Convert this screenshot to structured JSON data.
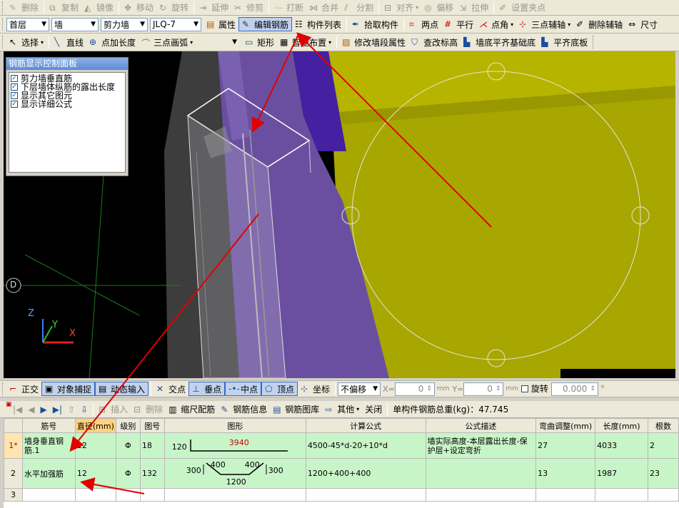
{
  "toolbar1": {
    "delete": "删除",
    "copy": "复制",
    "mirror": "镜像",
    "move": "移动",
    "rotate": "旋转",
    "extend": "延伸",
    "trim": "修剪",
    "break": "打断",
    "merge": "合并",
    "split": "分割",
    "align": "对齐",
    "offset": "偏移",
    "stretch": "拉伸",
    "set_grip": "设置夹点"
  },
  "toolbar2": {
    "floor": "首层",
    "category": "墙",
    "type": "剪力墙",
    "member": "JLQ-7",
    "properties": "属性",
    "edit_rebar": "编辑钢筋",
    "member_list": "构件列表",
    "pick_member": "拾取构件",
    "two_points": "两点",
    "parallel": "平行",
    "point_angle": "点角",
    "three_point_axis": "三点辅轴",
    "delete_axis": "删除辅轴",
    "size": "尺寸"
  },
  "toolbar3": {
    "select": "选择",
    "line": "直线",
    "point_length": "点加长度",
    "arc": "三点画弧",
    "blank_combo": "",
    "rect": "矩形",
    "smart_layout": "智能布置",
    "modify_seg": "修改墙段属性",
    "check_elev": "查改标高",
    "wall_bottom_align": "墙底平齐基础底",
    "align_bottom": "平齐底板"
  },
  "control_panel": {
    "title": "钢筋显示控制面板",
    "items": [
      "剪力墙垂直筋",
      "下层墙体纵筋的露出长度",
      "显示其它图元",
      "显示详细公式"
    ]
  },
  "viewport": {
    "axis_label": "D",
    "z": "Z",
    "y": "Y",
    "x": "X"
  },
  "snap_bar": {
    "ortho": "正交",
    "obj_snap": "对象捕捉",
    "dyn_input": "动态输入",
    "intersect": "交点",
    "perp": "垂点",
    "mid": "中点",
    "vertex": "顶点",
    "coord": "坐标",
    "offset_mode": "不偏移",
    "x_label": "X=",
    "x_val": "0",
    "unit1": "mm",
    "y_label": "Y=",
    "y_val": "0",
    "unit2": "mm",
    "rotate": "旋转",
    "rotate_val": "0.000",
    "deg": "°"
  },
  "rebar_toolbar": {
    "insert": "插入",
    "delete": "删除",
    "scale_rebar": "缩尺配筋",
    "rebar_info": "钢筋信息",
    "rebar_lib": "钢筋图库",
    "other": "其他",
    "close": "关闭",
    "total": "单构件钢筋总重(kg)：47.745"
  },
  "grid": {
    "headers": [
      "筋号",
      "直径(mm)",
      "级别",
      "图号",
      "图形",
      "计算公式",
      "公式描述",
      "弯曲调整(mm)",
      "长度(mm)",
      "根数"
    ],
    "rows": [
      {
        "no": "1*",
        "name": "墙身垂直钢筋.1",
        "dia": "12",
        "grade": "Φ",
        "fig": "18",
        "shape_left": "120",
        "shape_mid": "3940",
        "formula": "4500-45*d-20+10*d",
        "desc": "墙实际高度-本层露出长度-保护层+设定弯折",
        "bend": "27",
        "len": "4033",
        "count": "2"
      },
      {
        "no": "2",
        "name": "水平加强筋",
        "dia": "12",
        "grade": "Φ",
        "fig": "132",
        "shape_a": "300",
        "shape_b": "400",
        "shape_c": "400",
        "shape_d": "300",
        "shape_e": "1200",
        "formula": "1200+400+400",
        "desc": "",
        "bend": "13",
        "len": "1987",
        "count": "23"
      },
      {
        "no": "3"
      }
    ]
  }
}
